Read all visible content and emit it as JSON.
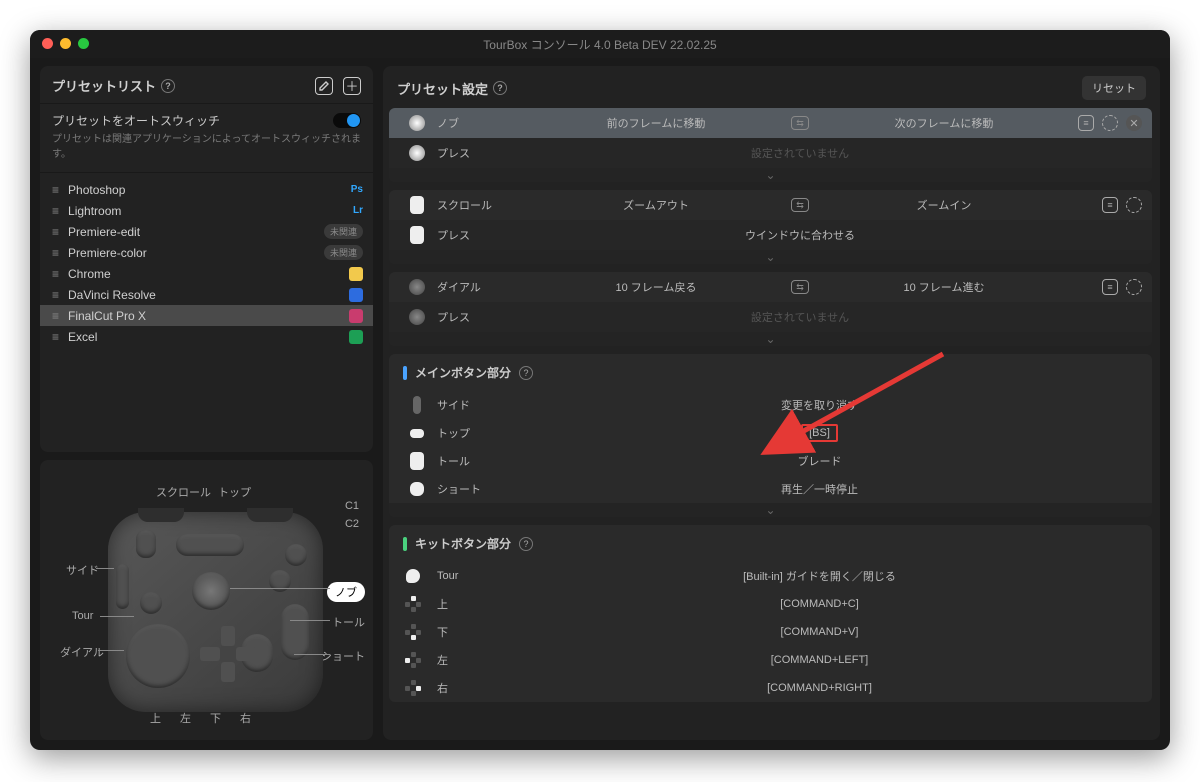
{
  "window": {
    "title": "TourBox コンソール 4.0 Beta DEV 22.02.25"
  },
  "sidebar": {
    "header": "プリセットリスト",
    "autoswitch_title": "プリセットをオートスウィッチ",
    "autoswitch_desc": "プリセットは関連アプリケーションによってオートスウィッチされます。",
    "presets": [
      {
        "name": "Photoshop",
        "tag": "Ps",
        "tagColor": "#31a8ff",
        "icon": null,
        "badge": null,
        "sel": false
      },
      {
        "name": "Lightroom",
        "tag": "Lr",
        "tagColor": "#31a8ff",
        "icon": null,
        "badge": null,
        "sel": false
      },
      {
        "name": "Premiere-edit",
        "tag": null,
        "tagColor": null,
        "icon": null,
        "badge": "未関連",
        "sel": false
      },
      {
        "name": "Premiere-color",
        "tag": null,
        "tagColor": null,
        "icon": null,
        "badge": "未関連",
        "sel": false
      },
      {
        "name": "Chrome",
        "tag": null,
        "tagColor": null,
        "icon": "#f2c94c",
        "badge": null,
        "sel": false
      },
      {
        "name": "DaVinci Resolve",
        "tag": null,
        "tagColor": null,
        "icon": "#2d6cdf",
        "badge": null,
        "sel": false
      },
      {
        "name": "FinalCut Pro X",
        "tag": null,
        "tagColor": null,
        "icon": "#c93c6e",
        "badge": null,
        "sel": true
      },
      {
        "name": "Excel",
        "tag": null,
        "tagColor": null,
        "icon": "#1d9f55",
        "badge": null,
        "sel": false
      }
    ]
  },
  "device_labels": {
    "scroll": "スクロール",
    "top": "トップ",
    "c1": "C1",
    "c2": "C2",
    "side": "サイド",
    "tour": "Tour",
    "dial": "ダイアル",
    "knob": "ノブ",
    "tall": "トール",
    "short": "ショート",
    "up": "上",
    "left": "左",
    "down": "下",
    "right": "右"
  },
  "settings": {
    "header": "プリセット設定",
    "reset": "リセット",
    "unset": "設定されていません",
    "rotary": [
      {
        "name": "ノブ",
        "left": "前のフレームに移動",
        "right": "次のフレームに移動",
        "icon": "knob",
        "sel": true,
        "close": true,
        "press": true
      },
      {
        "name": "スクロール",
        "left": "ズームアウト",
        "right": "ズームイン",
        "icon": "rect",
        "sel": false,
        "close": false,
        "press": "ウインドウに合わせる"
      },
      {
        "name": "ダイアル",
        "left": "10 フレーム戻る",
        "right": "10 フレーム進む",
        "icon": "knobdark",
        "sel": false,
        "close": false,
        "press": true
      }
    ],
    "press_label": "プレス",
    "main_section": "メインボタン部分",
    "main": [
      {
        "icon": "side",
        "name": "サイド",
        "value": "変更を取り消す"
      },
      {
        "icon": "top",
        "name": "トップ",
        "value": "[BS]",
        "boxed": true
      },
      {
        "icon": "tall",
        "name": "トール",
        "value": "ブレード"
      },
      {
        "icon": "short",
        "name": "ショート",
        "value": "再生／一時停止"
      }
    ],
    "kit_section": "キットボタン部分",
    "kit": [
      {
        "icon": "tour",
        "name": "Tour",
        "value": "[Built-in] ガイドを開く／閉じる"
      },
      {
        "icon": "up",
        "name": "上",
        "value": "[COMMAND+C]"
      },
      {
        "icon": "down",
        "name": "下",
        "value": "[COMMAND+V]"
      },
      {
        "icon": "left",
        "name": "左",
        "value": "[COMMAND+LEFT]"
      },
      {
        "icon": "right",
        "name": "右",
        "value": "[COMMAND+RIGHT]"
      }
    ]
  }
}
